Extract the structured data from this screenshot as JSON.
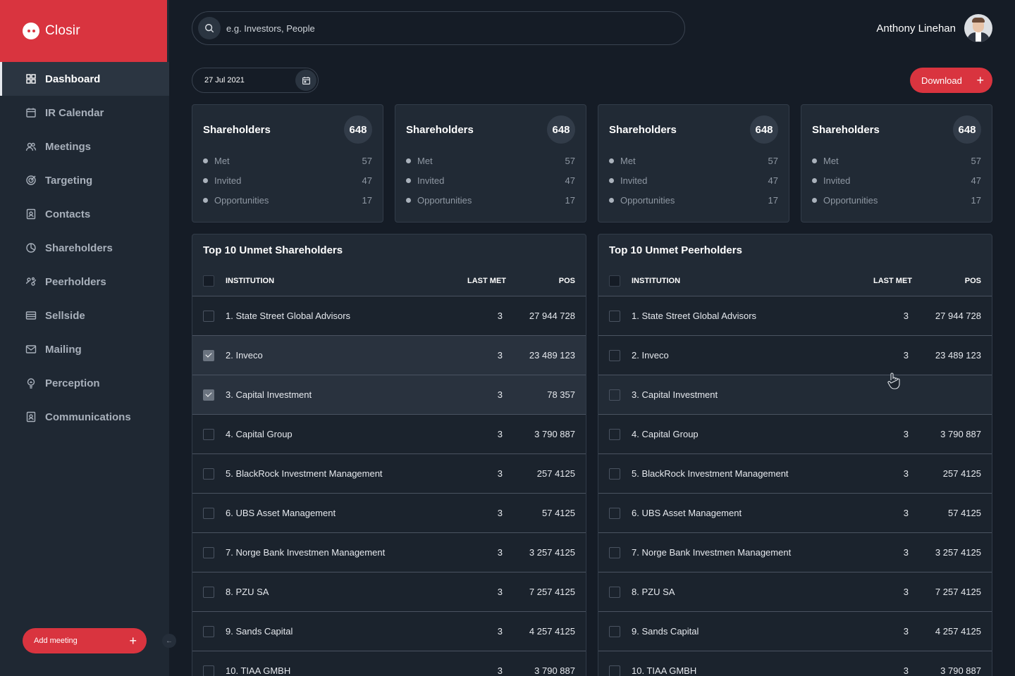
{
  "brand": {
    "name": "Closir"
  },
  "nav": [
    {
      "label": "Dashboard",
      "icon": "grid-icon",
      "active": true
    },
    {
      "label": "IR Calendar",
      "icon": "calendar-icon"
    },
    {
      "label": "Meetings",
      "icon": "people-icon"
    },
    {
      "label": "Targeting",
      "icon": "target-icon"
    },
    {
      "label": "Contacts",
      "icon": "contact-card-icon"
    },
    {
      "label": "Shareholders",
      "icon": "pie-chart-icon"
    },
    {
      "label": "Peerholders",
      "icon": "peer-icon"
    },
    {
      "label": "Sellside",
      "icon": "list-icon"
    },
    {
      "label": "Mailing",
      "icon": "mail-icon"
    },
    {
      "label": "Perception",
      "icon": "bulb-icon"
    },
    {
      "label": "Communications",
      "icon": "contact-card-icon"
    }
  ],
  "add_meeting_label": "Add meeting",
  "search": {
    "placeholder": "e.g. Investors, People"
  },
  "user": {
    "name": "Anthony Linehan"
  },
  "date": "27 Jul 2021",
  "download_label": "Download",
  "cards": [
    {
      "title": "Shareholders",
      "count": "648",
      "rows": [
        {
          "label": "Met",
          "value": "57"
        },
        {
          "label": "Invited",
          "value": "47"
        },
        {
          "label": "Opportunities",
          "value": "17"
        }
      ]
    },
    {
      "title": "Shareholders",
      "count": "648",
      "rows": [
        {
          "label": "Met",
          "value": "57"
        },
        {
          "label": "Invited",
          "value": "47"
        },
        {
          "label": "Opportunities",
          "value": "17"
        }
      ]
    },
    {
      "title": "Shareholders",
      "count": "648",
      "rows": [
        {
          "label": "Met",
          "value": "57"
        },
        {
          "label": "Invited",
          "value": "47"
        },
        {
          "label": "Opportunities",
          "value": "17"
        }
      ]
    },
    {
      "title": "Shareholders",
      "count": "648",
      "rows": [
        {
          "label": "Met",
          "value": "57"
        },
        {
          "label": "Invited",
          "value": "47"
        },
        {
          "label": "Opportunities",
          "value": "17"
        }
      ]
    }
  ],
  "tables": [
    {
      "title": "Top 10 Unmet Shareholders",
      "columns": {
        "institution": "INSTITUTION",
        "last_met": "LAST MET",
        "pos": "POS"
      },
      "rows": [
        {
          "institution": "1. State Street Global Advisors",
          "last_met": "3",
          "pos": "27 944 728",
          "checked": false
        },
        {
          "institution": "2. Inveco",
          "last_met": "3",
          "pos": "23 489 123",
          "checked": true
        },
        {
          "institution": "3. Capital Investment",
          "last_met": "3",
          "pos": "78 357",
          "checked": true
        },
        {
          "institution": "4. Capital Group",
          "last_met": "3",
          "pos": "3 790 887",
          "checked": false
        },
        {
          "institution": "5. BlackRock Investment Management",
          "last_met": "3",
          "pos": "257 4125",
          "checked": false
        },
        {
          "institution": "6. UBS Asset Management",
          "last_met": "3",
          "pos": "57 4125",
          "checked": false
        },
        {
          "institution": "7. Norge Bank Investmen Management",
          "last_met": "3",
          "pos": "3 257 4125",
          "checked": false
        },
        {
          "institution": "8. PZU SA",
          "last_met": "3",
          "pos": "7 257 4125",
          "checked": false
        },
        {
          "institution": "9. Sands Capital",
          "last_met": "3",
          "pos": "4 257 4125",
          "checked": false
        },
        {
          "institution": "10. TIAA GMBH",
          "last_met": "3",
          "pos": "3 790 887",
          "checked": false
        }
      ]
    },
    {
      "title": "Top 10 Unmet Peerholders",
      "columns": {
        "institution": "INSTITUTION",
        "last_met": "LAST MET",
        "pos": "POS"
      },
      "rows": [
        {
          "institution": "1. State Street Global Advisors",
          "last_met": "3",
          "pos": "27 944 728",
          "checked": false
        },
        {
          "institution": "2. Inveco",
          "last_met": "3",
          "pos": "23 489 123",
          "checked": false
        },
        {
          "institution": "3. Capital Investment",
          "last_met": "",
          "pos": "",
          "checked": false,
          "hover": true
        },
        {
          "institution": "4. Capital Group",
          "last_met": "3",
          "pos": "3 790 887",
          "checked": false
        },
        {
          "institution": "5. BlackRock Investment Management",
          "last_met": "3",
          "pos": "257 4125",
          "checked": false
        },
        {
          "institution": "6. UBS Asset Management",
          "last_met": "3",
          "pos": "57 4125",
          "checked": false
        },
        {
          "institution": "7. Norge Bank Investmen Management",
          "last_met": "3",
          "pos": "3 257 4125",
          "checked": false
        },
        {
          "institution": "8. PZU SA",
          "last_met": "3",
          "pos": "7 257 4125",
          "checked": false
        },
        {
          "institution": "9. Sands Capital",
          "last_met": "3",
          "pos": "4 257 4125",
          "checked": false
        },
        {
          "institution": "10. TIAA GMBH",
          "last_met": "3",
          "pos": "3 790 887",
          "checked": false
        }
      ]
    }
  ],
  "colors": {
    "accent": "#d9343f",
    "background": "#151c26",
    "sidebar": "#1f2833",
    "card": "#212a35"
  }
}
